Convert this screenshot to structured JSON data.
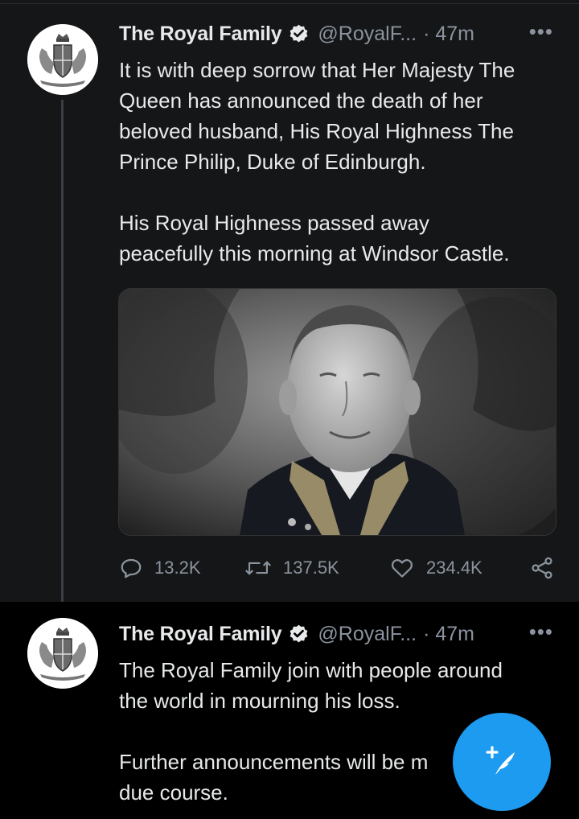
{
  "tweets": [
    {
      "author_name": "The Royal Family",
      "handle": "@RoyalF...",
      "time": "· 47m",
      "more": "•••",
      "lines": [
        "It is with deep sorrow that Her Majesty The",
        "Queen has announced the death of her",
        "beloved husband, His Royal Highness The",
        "Prince Philip, Duke of Edinburgh.",
        "",
        "His Royal Highness passed away",
        "peacefully this morning at Windsor Castle."
      ],
      "stats": {
        "replies": "13.2K",
        "retweets": "137.5K",
        "likes": "234.4K"
      }
    },
    {
      "author_name": "The Royal Family",
      "handle": "@RoyalF...",
      "time": "· 47m",
      "more": "•••",
      "lines": [
        "The Royal Family join with people around",
        "the world in mourning his loss.",
        "",
        "Further announcements will be m",
        "due course."
      ]
    }
  ],
  "icons": {
    "verified": "verified-badge-icon",
    "reply": "reply-icon",
    "retweet": "retweet-icon",
    "like": "heart-icon",
    "share": "share-icon",
    "compose": "compose-icon"
  },
  "colors": {
    "accent": "#1d9bf0",
    "background": "#000000",
    "tweet_highlight": "#151618",
    "secondary_text": "#8b949e"
  }
}
